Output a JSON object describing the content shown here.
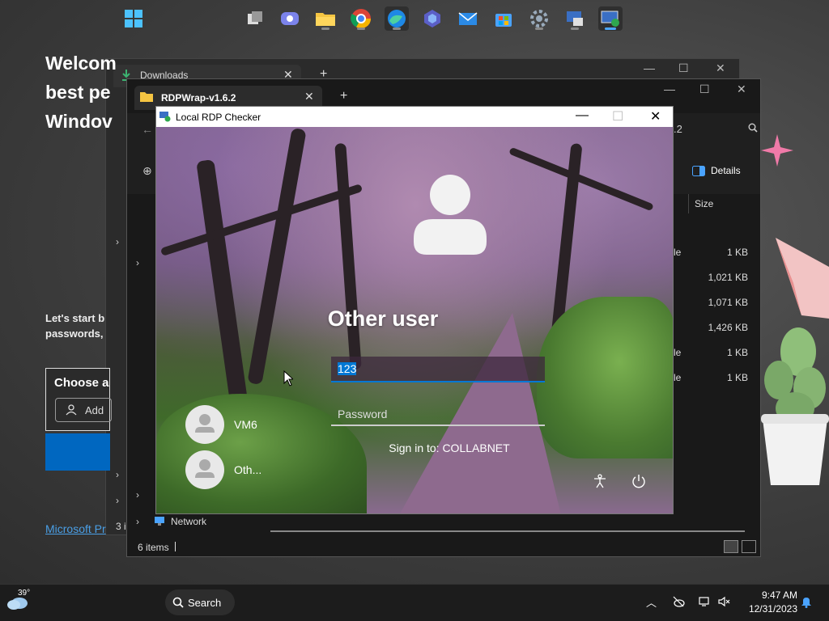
{
  "edge": {
    "tab_label": "Downloads",
    "welcome_title": "Welcom\nbest pe\nWindov",
    "welcome_sub": "Let's start b\npasswords,",
    "choose_label": "Choose a",
    "add_label": "Add",
    "ms_link": "Microsoft Pr"
  },
  "explorer": {
    "tab_label": "RDPWrap-v1.6.2",
    "path_fragment": ".2",
    "details_label": "Details",
    "size_header": "Size",
    "files": [
      {
        "name_frag": "le",
        "size": "1 KB"
      },
      {
        "name_frag": "",
        "size": "1,021 KB"
      },
      {
        "name_frag": "",
        "size": "1,071 KB"
      },
      {
        "name_frag": "",
        "size": "1,426 KB"
      },
      {
        "name_frag": "le",
        "size": "1 KB"
      },
      {
        "name_frag": "le",
        "size": "1 KB"
      }
    ],
    "network_label": "Network",
    "status_items": "6 items",
    "status_frag": "3 i"
  },
  "rdp": {
    "window_title": "Local RDP Checker",
    "user_name": "Other user",
    "username_value": "123",
    "password_placeholder": "Password",
    "sign_in_to": "Sign in to: COLLABNET",
    "users": [
      {
        "name": "VM6"
      },
      {
        "name": "Oth..."
      }
    ]
  },
  "taskbar": {
    "weather_temp": "39°",
    "search_label": "Search",
    "time": "9:47 AM",
    "date": "12/31/2023",
    "apps": [
      "start-icon",
      "task-view-icon",
      "teams-icon",
      "file-explorer-icon",
      "chrome-icon",
      "edge-icon",
      "copilot-icon",
      "mail-icon",
      "store-icon",
      "settings-icon",
      "rdp-config-icon",
      "rdp-checker-icon"
    ]
  },
  "colors": {
    "accent": "#0078d4",
    "taskbar_bg": "#1c1c1c"
  }
}
